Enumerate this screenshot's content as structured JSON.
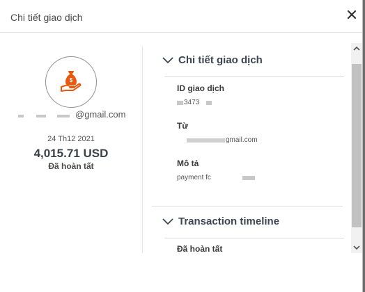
{
  "modal": {
    "title": "Chi tiết giao dịch",
    "close_icon": "close-icon"
  },
  "summary": {
    "avatar_icon": "money-bag-hand-icon",
    "avatar_color": "#e8590c",
    "email_suffix": "@gmail.com",
    "date": "24 Th12 2021",
    "amount": "4,015.71 USD",
    "status": "Đã hoàn tất"
  },
  "details": {
    "heading": "Chi tiết giao dịch",
    "chevron_icon": "chevron-down-icon",
    "fields": [
      {
        "label": "ID giao dịch",
        "value": "3473"
      },
      {
        "label": "Từ",
        "value": "gmail.com"
      },
      {
        "label": "Mô tả",
        "value": "payment fc"
      }
    ]
  },
  "timeline": {
    "heading": "Transaction timeline",
    "chevron_icon": "chevron-down-icon",
    "first_entry": "Đã hoàn tất"
  },
  "scrollbar": {
    "up_icon": "scroll-up-arrow-icon",
    "down_icon": "scroll-down-arrow-icon"
  }
}
